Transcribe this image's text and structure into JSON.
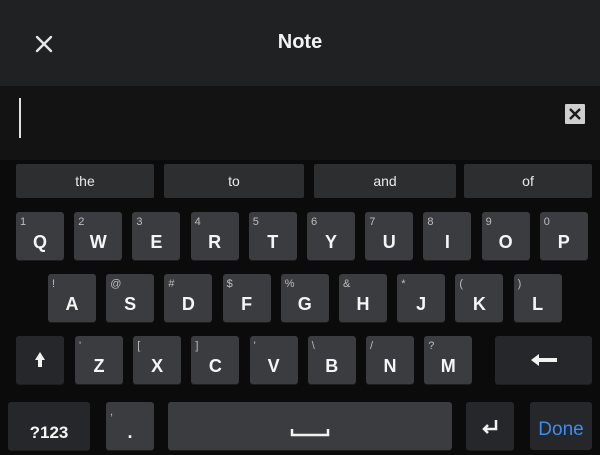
{
  "title": "Note",
  "input": {
    "value": "",
    "placeholder": ""
  },
  "suggestions": [
    "the",
    "to",
    "and",
    "of"
  ],
  "row1": [
    {
      "main": "Q",
      "hint": "1"
    },
    {
      "main": "W",
      "hint": "2"
    },
    {
      "main": "E",
      "hint": "3"
    },
    {
      "main": "R",
      "hint": "4"
    },
    {
      "main": "T",
      "hint": "5"
    },
    {
      "main": "Y",
      "hint": "6"
    },
    {
      "main": "U",
      "hint": "7"
    },
    {
      "main": "I",
      "hint": "8"
    },
    {
      "main": "O",
      "hint": "9"
    },
    {
      "main": "P",
      "hint": "0"
    }
  ],
  "row2": [
    {
      "main": "A",
      "hint": "!"
    },
    {
      "main": "S",
      "hint": "@"
    },
    {
      "main": "D",
      "hint": "#"
    },
    {
      "main": "F",
      "hint": "$"
    },
    {
      "main": "G",
      "hint": "%"
    },
    {
      "main": "H",
      "hint": "&"
    },
    {
      "main": "J",
      "hint": "*"
    },
    {
      "main": "K",
      "hint": "("
    },
    {
      "main": "L",
      "hint": ")"
    }
  ],
  "row3": [
    {
      "main": "Z",
      "hint": "'"
    },
    {
      "main": "X",
      "hint": "["
    },
    {
      "main": "C",
      "hint": "]"
    },
    {
      "main": "V",
      "hint": "'"
    },
    {
      "main": "B",
      "hint": "\\"
    },
    {
      "main": "N",
      "hint": "/"
    },
    {
      "main": "M",
      "hint": "?"
    }
  ],
  "bottom": {
    "symbols_label": "?123",
    "period_label": ".",
    "period_hint": ",",
    "done_label": "Done"
  },
  "icons": {
    "close": "close-icon",
    "clear": "clear-text-icon",
    "shift": "shift-icon",
    "backspace": "backspace-icon",
    "space": "space-bar-icon",
    "enter": "enter-icon"
  },
  "colors": {
    "background": "#070707",
    "topbar": "#202122",
    "key": "#3b3c3f",
    "key_dark": "#26272a",
    "accent": "#3b8df2"
  }
}
